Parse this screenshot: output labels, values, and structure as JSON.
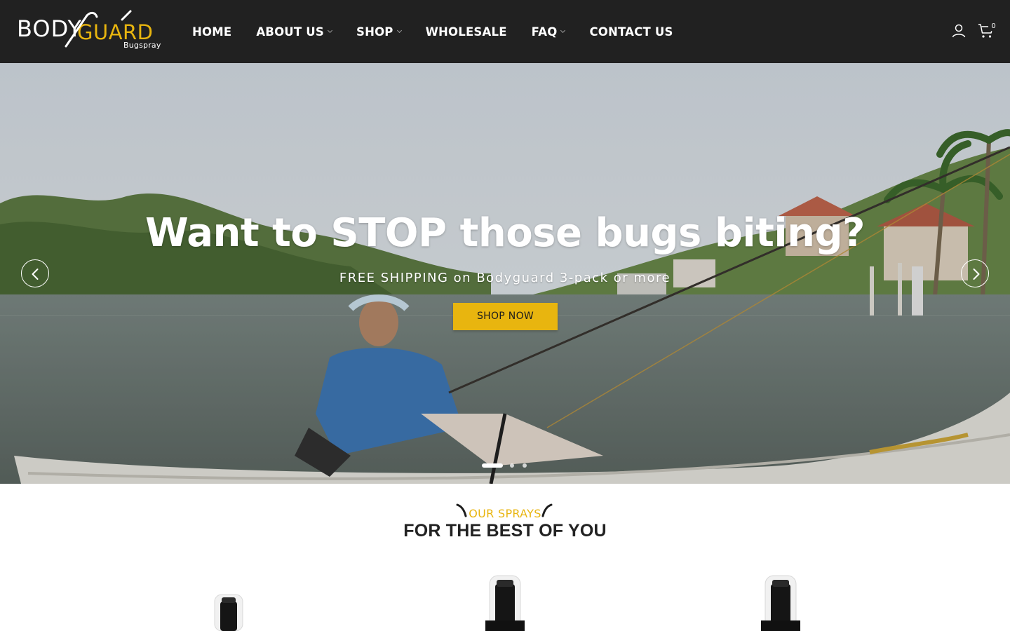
{
  "brand": {
    "logo_text": "BODYGUARD",
    "logo_subtext": "Bugspray",
    "accent_color": "#e8b50f",
    "header_bg": "#212121"
  },
  "nav": {
    "items": [
      {
        "label": "HOME",
        "has_dropdown": false
      },
      {
        "label": "ABOUT US",
        "has_dropdown": true
      },
      {
        "label": "SHOP",
        "has_dropdown": true
      },
      {
        "label": "WHOLESALE",
        "has_dropdown": false
      },
      {
        "label": "FAQ",
        "has_dropdown": true
      },
      {
        "label": "CONTACT US",
        "has_dropdown": false
      }
    ]
  },
  "header_icons": {
    "account": "user-icon",
    "cart": "cart-icon",
    "cart_count": "0"
  },
  "hero": {
    "title": "Want to STOP those bugs biting?",
    "subtitle": "FREE SHIPPING on Bodyguard 3-pack or more",
    "cta_label": "SHOP NOW",
    "slide_count": 3,
    "active_slide": 1
  },
  "section": {
    "eyebrow": "OUR SPRAYS",
    "title": "FOR THE BEST OF YOU"
  }
}
